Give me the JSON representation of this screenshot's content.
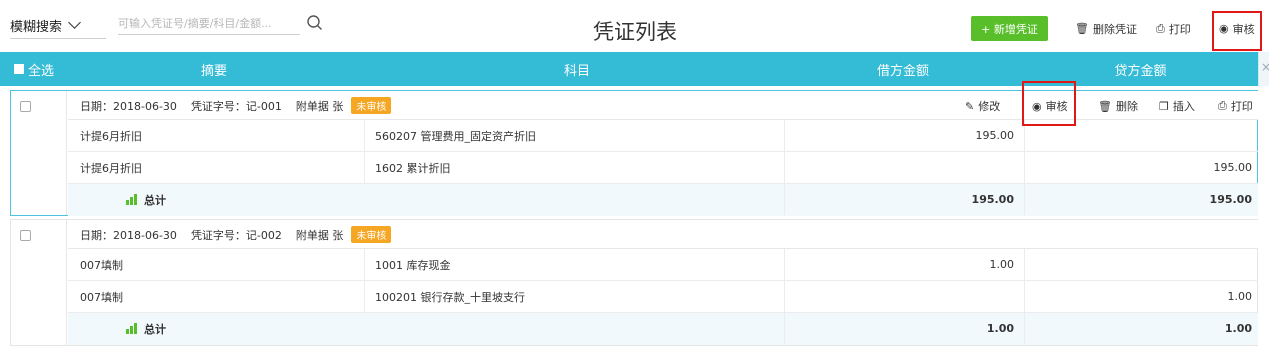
{
  "toolbar": {
    "search_mode": "模糊搜索",
    "search_placeholder": "可输入凭证号/摘要/科目/金额...",
    "title": "凭证列表",
    "new_button": "+ 新增凭证",
    "delete_button": "删除凭证",
    "print_button": "打印",
    "audit_button": "审核"
  },
  "table_header": {
    "select_all": "全选",
    "summary": "摘要",
    "subject": "科目",
    "debit": "借方金额",
    "credit": "贷方金额"
  },
  "voucher_actions": {
    "edit": "修改",
    "audit": "审核",
    "delete": "删除",
    "insert": "插入",
    "print": "打印"
  },
  "vouchers": [
    {
      "date": "日期：2018-06-30",
      "number": "凭证字号：记-001",
      "attachments": "附单据 张",
      "status": "未审核",
      "entries": [
        {
          "summary": "计提6月折旧",
          "subject": "560207 管理费用_固定资产折旧",
          "debit": "195.00",
          "credit": ""
        },
        {
          "summary": "计提6月折旧",
          "subject": "1602 累计折旧",
          "debit": "",
          "credit": "195.00"
        }
      ],
      "total_label": "总计",
      "total_debit": "195.00",
      "total_credit": "195.00"
    },
    {
      "date": "日期：2018-06-30",
      "number": "凭证字号：记-002",
      "attachments": "附单据 张",
      "status": "未审核",
      "entries": [
        {
          "summary": "007填制",
          "subject": "1001 库存现金",
          "debit": "1.00",
          "credit": ""
        },
        {
          "summary": "007填制",
          "subject": "100201 银行存款_十里坡支行",
          "debit": "",
          "credit": "1.00"
        }
      ],
      "total_label": "总计",
      "total_debit": "1.00",
      "total_credit": "1.00"
    }
  ],
  "colors": {
    "header_bg": "#34bbd6",
    "primary_green": "#58bf2b",
    "status_badge": "#f5a623",
    "highlight_red": "#e01818"
  }
}
